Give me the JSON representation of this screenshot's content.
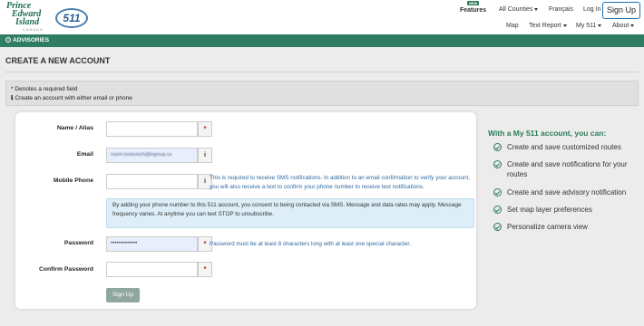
{
  "header": {
    "logo_pei_lines": [
      "Prince",
      "Edward",
      "Island"
    ],
    "logo_pei_sub": "CANADA",
    "logo_511": "511",
    "features_badge": "NEW",
    "features": "Features",
    "all_counties": "All Counties",
    "francais": "Français",
    "login": "Log In",
    "signup": "Sign Up",
    "map": "Map",
    "text_report": "Text Report",
    "my511": "My 511",
    "about": "About"
  },
  "advisories_label": "ADVISORIES",
  "page_title": "CREATE A NEW ACCOUNT",
  "notice": {
    "line1": "* Denotes a required field",
    "line2": "Create an account with either email or phone"
  },
  "form": {
    "name_label": "Name / Alias",
    "name_value": "",
    "email_label": "Email",
    "email_value": "nasim.toolsomchi@logroup.ca",
    "phone_label": "Mobile Phone",
    "phone_value": "",
    "phone_help": "This is required to receive SMS notifications. In addition to an email confirmation to verify your account, you will also receive a text to confirm your phone number to receive text notifications.",
    "consent": "By adding your phone number to this 511 account, you consent to being contacted via SMS. Message and data rates may apply. Message frequency varies. At anytime you can text STOP to unsubscribe.",
    "password_label": "Password",
    "password_value": "••••••••••••••",
    "password_help": "Password must be at least 8 characters long with at least one special character.",
    "confirm_label": "Confirm Password",
    "confirm_value": "",
    "required_mark": "*",
    "info_mark": "i",
    "submit": "Sign Up"
  },
  "benefits": {
    "title": "With a My 511 account, you can:",
    "items": [
      "Create and save customized routes",
      "Create and save notifications for your routes",
      "Create and save advisory notification",
      "Set map layer preferences",
      "Personalize camera view"
    ]
  },
  "colors": {
    "brand_green": "#2e7d64",
    "link_blue": "#2d6a9f",
    "required_red": "#c0392b"
  }
}
